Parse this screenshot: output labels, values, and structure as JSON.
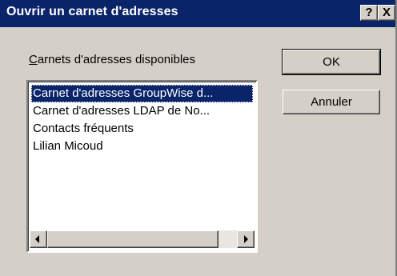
{
  "window": {
    "title": "Ouvrir un carnet d'adresses",
    "help_glyph": "?",
    "close_glyph": "X"
  },
  "list": {
    "label_prefix": "C",
    "label_rest": "arnets d'adresses disponibles",
    "items": [
      {
        "label": "Carnet d'adresses GroupWise d...",
        "selected": true
      },
      {
        "label": "Carnet d'adresses LDAP de No...",
        "selected": false
      },
      {
        "label": "Contacts fréquents",
        "selected": false
      },
      {
        "label": "Lilian Micoud",
        "selected": false
      }
    ]
  },
  "buttons": {
    "ok_label": "OK",
    "cancel_label": "Annuler"
  },
  "colors": {
    "titlebar": "#0a246a",
    "face": "#d4d0c8",
    "selection": "#0a246a"
  }
}
